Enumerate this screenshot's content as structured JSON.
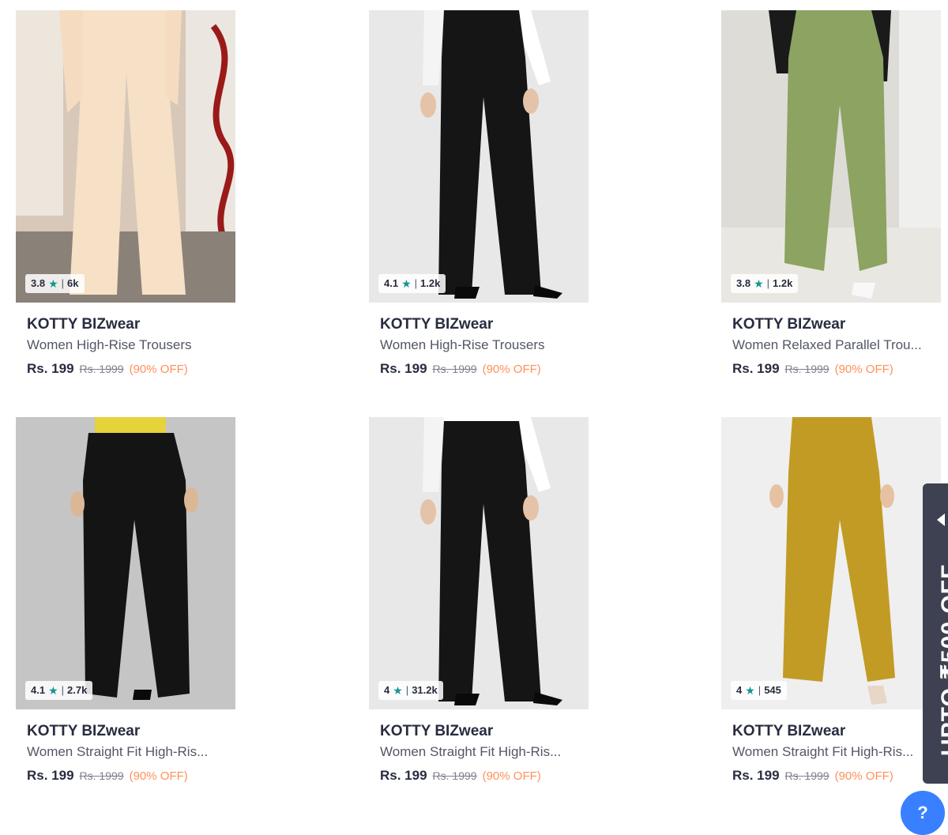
{
  "products": [
    {
      "brand": "KOTTY BIZwear",
      "title": "Women High-Rise Trousers",
      "rating": "3.8",
      "rating_count": "6k",
      "price": "Rs. 199",
      "mrp": "Rs. 1999",
      "discount": "(90% OFF)",
      "colors": {
        "bg": "#d9c9ba",
        "pant": "#f6dfc5"
      }
    },
    {
      "brand": "KOTTY BIZwear",
      "title": "Women High-Rise Trousers",
      "rating": "4.1",
      "rating_count": "1.2k",
      "price": "Rs. 199",
      "mrp": "Rs. 1999",
      "discount": "(90% OFF)",
      "colors": {
        "bg": "#e6e6e6",
        "pant": "#141414"
      }
    },
    {
      "brand": "KOTTY BIZwear",
      "title": "Women Relaxed Parallel Trou...",
      "rating": "3.8",
      "rating_count": "1.2k",
      "price": "Rs. 199",
      "mrp": "Rs. 1999",
      "discount": "(90% OFF)",
      "colors": {
        "bg": "#e3e1dc",
        "pant": "#8ea463"
      }
    },
    {
      "brand": "KOTTY BIZwear",
      "title": "Women Straight Fit High-Ris...",
      "rating": "4.1",
      "rating_count": "2.7k",
      "price": "Rs. 199",
      "mrp": "Rs. 1999",
      "discount": "(90% OFF)",
      "colors": {
        "bg": "#c4c4c4",
        "pant": "#141414"
      }
    },
    {
      "brand": "KOTTY BIZwear",
      "title": "Women Straight Fit High-Ris...",
      "rating": "4",
      "rating_count": "31.2k",
      "price": "Rs. 199",
      "mrp": "Rs. 1999",
      "discount": "(90% OFF)",
      "colors": {
        "bg": "#e6e6e6",
        "pant": "#141414"
      }
    },
    {
      "brand": "KOTTY BIZwear",
      "title": "Women Straight Fit High-Ris...",
      "rating": "4",
      "rating_count": "545",
      "price": "Rs. 199",
      "mrp": "Rs. 1999",
      "discount": "(90% OFF)",
      "colors": {
        "bg": "#eeeeee",
        "pant": "#c19a22"
      }
    }
  ],
  "offer_tab": {
    "text": "UPTO ₹500 OFF",
    "icon": "chevron-left-icon"
  },
  "help_button": {
    "icon": "help-icon"
  },
  "accent_colors": {
    "star": "#14958f",
    "discount": "#ff905a",
    "offer_tab": "#3e4152"
  }
}
